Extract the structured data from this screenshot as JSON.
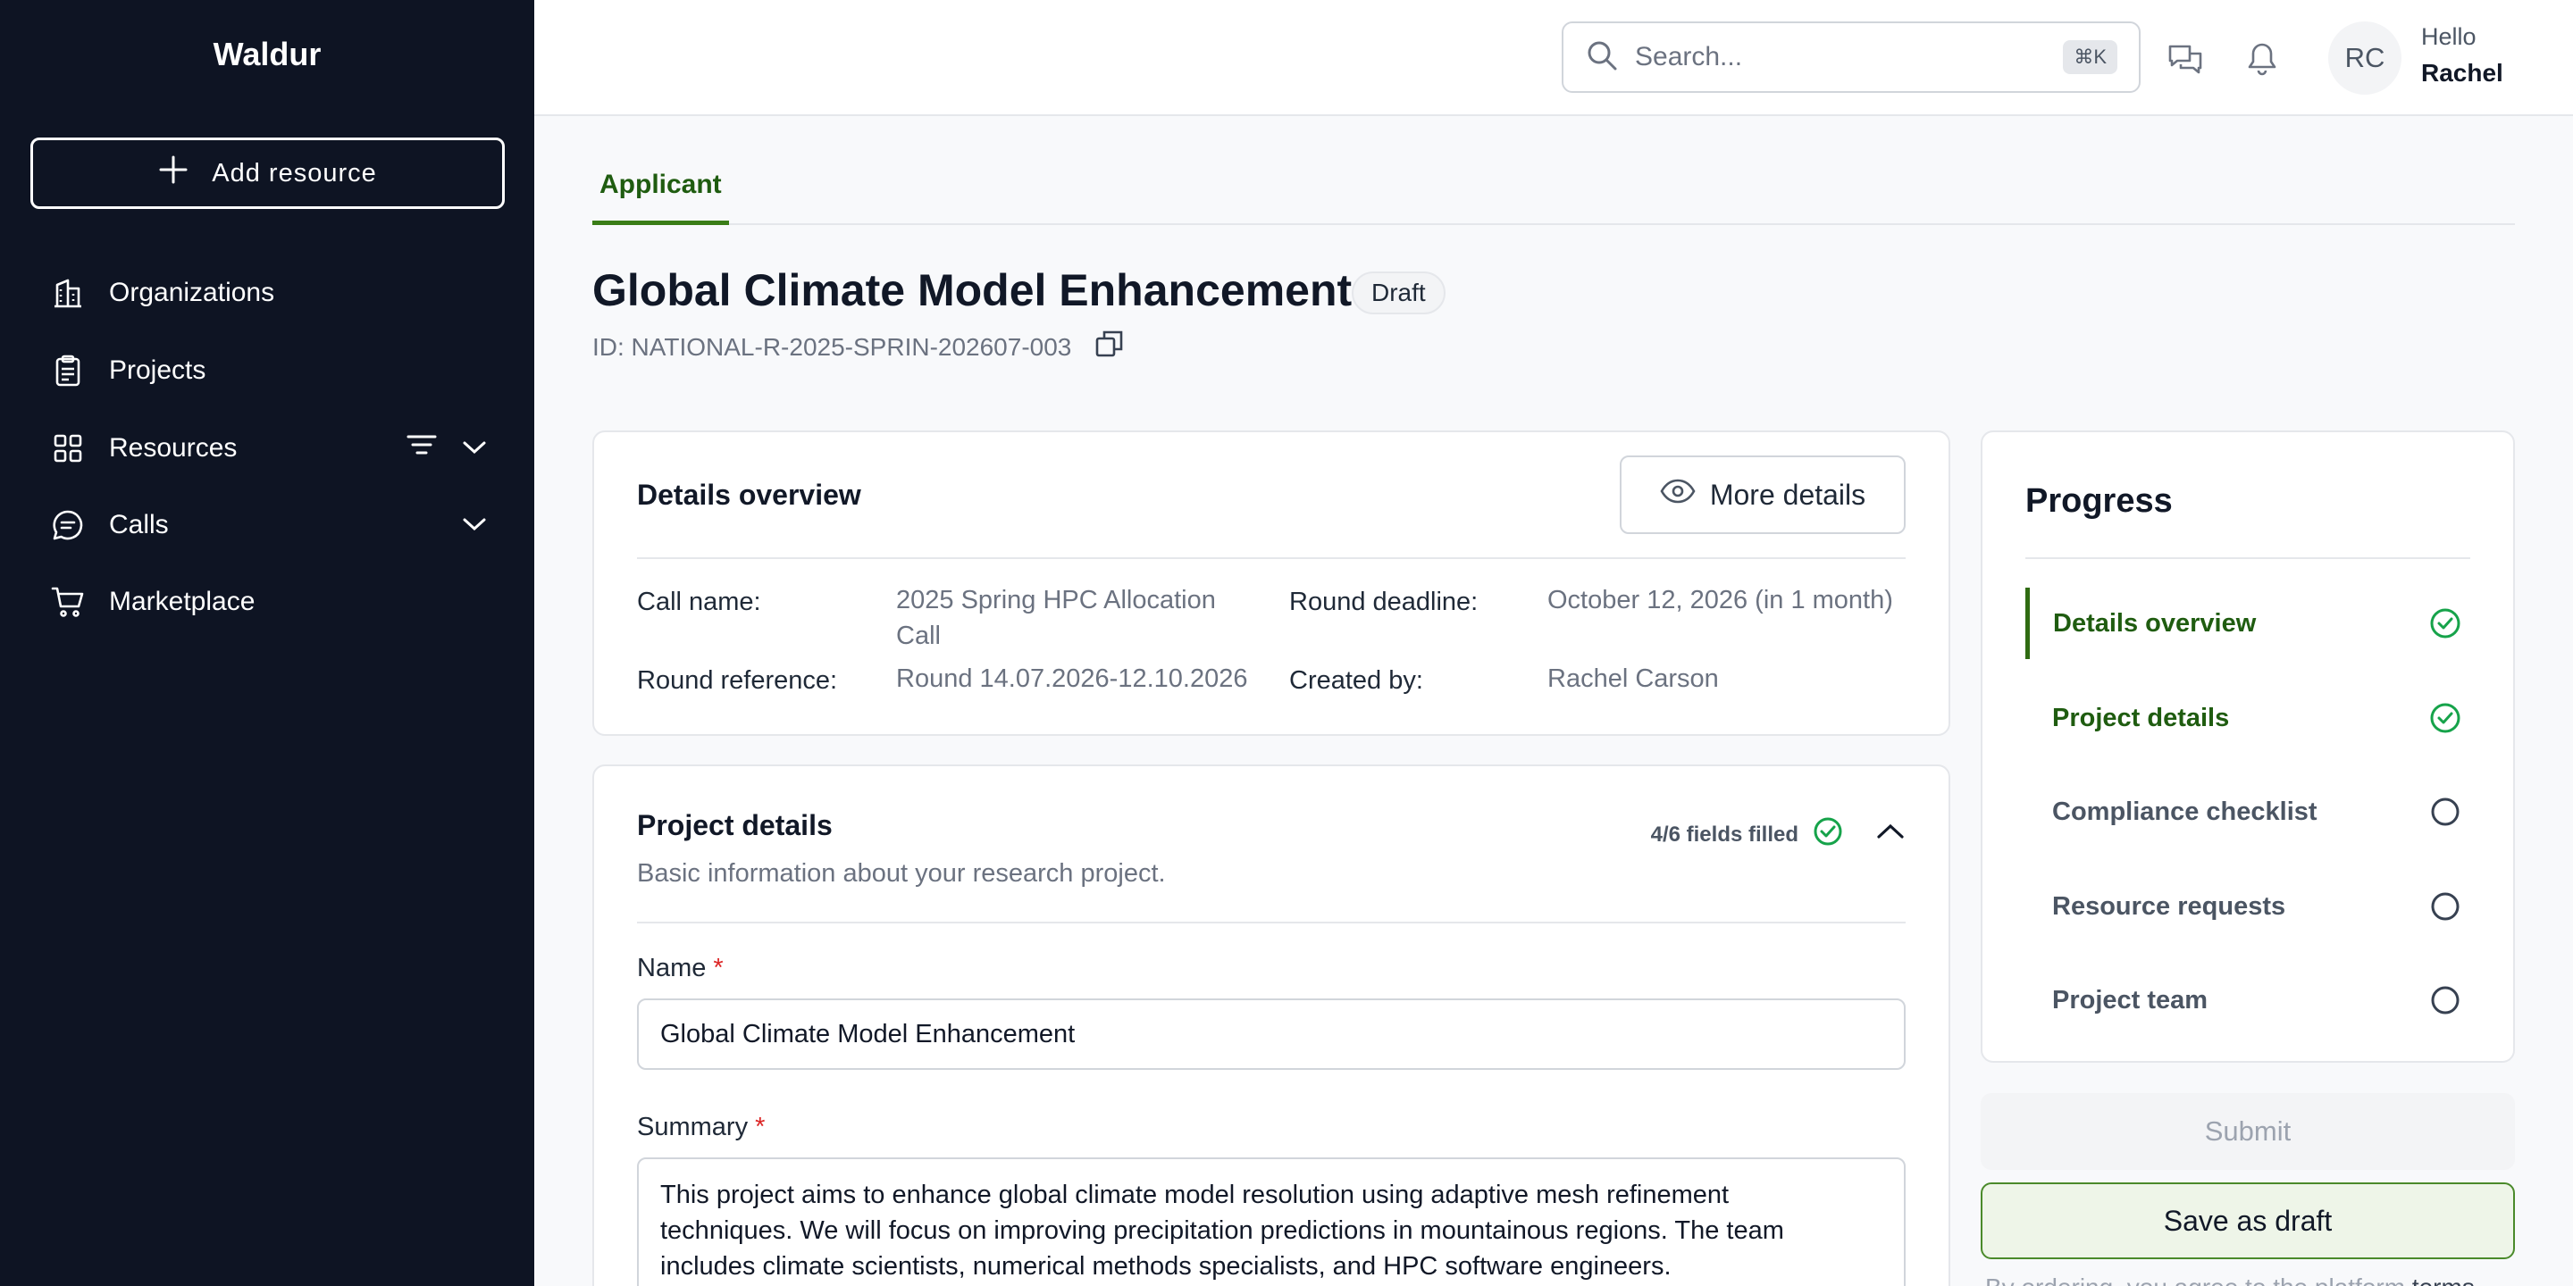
{
  "sidebar": {
    "brand": "Waldur",
    "add_resource": "Add resource",
    "items": [
      {
        "label": "Organizations",
        "icon": "building-icon"
      },
      {
        "label": "Projects",
        "icon": "clipboard-icon"
      },
      {
        "label": "Resources",
        "icon": "grid-icon"
      },
      {
        "label": "Calls",
        "icon": "chat-icon"
      },
      {
        "label": "Marketplace",
        "icon": "cart-icon"
      }
    ]
  },
  "topbar": {
    "search_placeholder": "Search...",
    "search_shortcut": "⌘K",
    "user_initials": "RC",
    "greeting": "Hello",
    "user_name": "Rachel"
  },
  "tabs": [
    {
      "label": "Applicant"
    }
  ],
  "page": {
    "title": "Global Climate Model Enhancement",
    "status": "Draft",
    "id_text": "ID: NATIONAL-R-2025-SPRIN-202607-003"
  },
  "overview": {
    "title": "Details overview",
    "more_button": "More details",
    "call_name_label": "Call name:",
    "call_name_value_line1": "2025 Spring HPC Allocation",
    "call_name_value_line2": "Call",
    "round_deadline_label": "Round deadline:",
    "round_deadline_value": "October 12, 2026 (in 1 month)",
    "round_reference_label": "Round reference:",
    "round_reference_value": "Round 14.07.2026-12.10.2026",
    "created_by_label": "Created by:",
    "created_by_value": "Rachel Carson"
  },
  "project_details": {
    "title": "Project details",
    "subtitle": "Basic information about your research project.",
    "fields_filled": "4/6 fields filled",
    "name_label": "Name",
    "name_value": "Global Climate Model Enhancement",
    "summary_label": "Summary",
    "required_mark": "*",
    "summary_line1": "This project aims to enhance global climate model resolution using adaptive mesh refinement",
    "summary_line2": "techniques. We will focus on improving precipitation predictions in mountainous regions. The team",
    "summary_line3": "includes climate scientists, numerical methods specialists, and HPC software engineers."
  },
  "progress": {
    "title": "Progress",
    "steps": [
      {
        "label": "Details overview",
        "state": "done"
      },
      {
        "label": "Project details",
        "state": "done"
      },
      {
        "label": "Compliance checklist",
        "state": "todo"
      },
      {
        "label": "Resource requests",
        "state": "todo"
      },
      {
        "label": "Project team",
        "state": "todo"
      }
    ],
    "submit": "Submit",
    "save_draft": "Save as draft",
    "terms_prefix": "By ordering, you agree to the platform",
    "terms_link": "terms"
  },
  "colors": {
    "sidebar_bg": "#0e1423",
    "accent_green": "#1f5c10",
    "check_green": "#16a34a"
  }
}
